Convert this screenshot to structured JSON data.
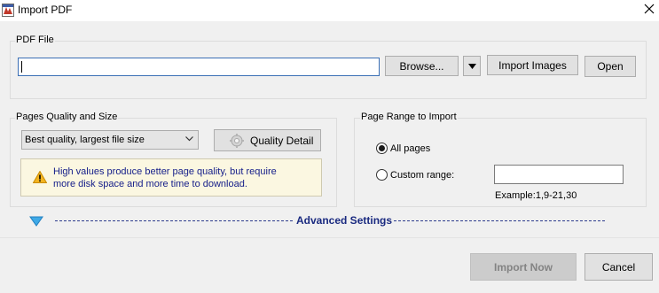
{
  "window": {
    "title": "Import PDF",
    "icon": "pdf-app-icon",
    "close_icon": "close-icon"
  },
  "pdf_file": {
    "group_label": "PDF File",
    "path_value": "",
    "browse_label": "Browse...",
    "dropdown_icon": "triangle-down-icon",
    "import_images_label": "Import Images",
    "open_label": "Open"
  },
  "quality": {
    "group_label": "Pages Quality and Size",
    "selected_option": "Best quality, largest file size",
    "detail_button_label": "Quality Detail",
    "detail_icon": "gear-icon",
    "warning_icon": "warning-icon",
    "warning_line1": "High values produce better page quality, but require",
    "warning_line2": "more disk space and more time to download."
  },
  "page_range": {
    "group_label": "Page Range to Import",
    "all_pages_label": "All pages",
    "all_pages_checked": true,
    "custom_range_label": "Custom range:",
    "custom_range_checked": false,
    "custom_range_value": "",
    "example_text": "Example:1,9-21,30"
  },
  "advanced": {
    "title": "Advanced Settings",
    "toggle_icon": "expand-down-icon"
  },
  "footer": {
    "import_now_label": "Import Now",
    "cancel_label": "Cancel"
  },
  "colors": {
    "accent_blue": "#1a2a80",
    "warning_bg": "#fbf7e1",
    "warning_text": "#17208a",
    "toggle_blue": "#3fa9e6"
  }
}
